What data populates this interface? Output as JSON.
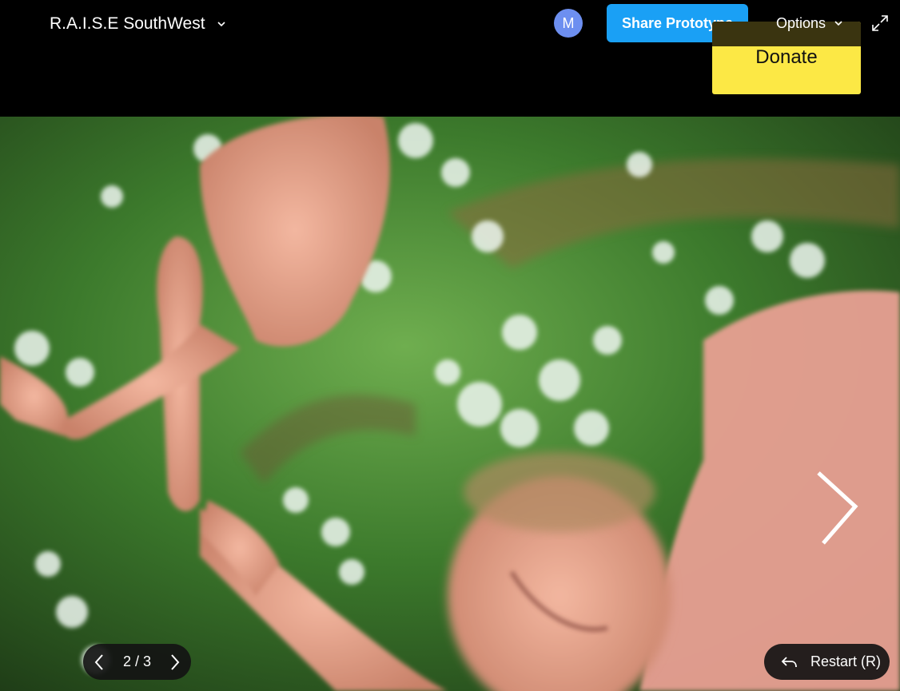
{
  "header": {
    "project_title": "R.A.I.S.E SouthWest",
    "avatar_initial": "M",
    "share_button_label": "Share Prototype",
    "options_label": "Options"
  },
  "overlay": {
    "donate_label": "Donate"
  },
  "player": {
    "page_indicator": "2 / 3",
    "restart_label": "Restart (R)"
  },
  "colors": {
    "share_button": "#1aa0f5",
    "avatar": "#6d8ff0",
    "donate": "#fce845"
  },
  "icons": {
    "project_menu": "chevron-down-icon",
    "options_menu": "chevron-down-icon",
    "fullscreen": "expand-icon",
    "next_slide": "chevron-right-icon",
    "pager_prev": "chevron-left-icon",
    "pager_next": "chevron-right-icon",
    "restart": "return-arrow-icon"
  }
}
